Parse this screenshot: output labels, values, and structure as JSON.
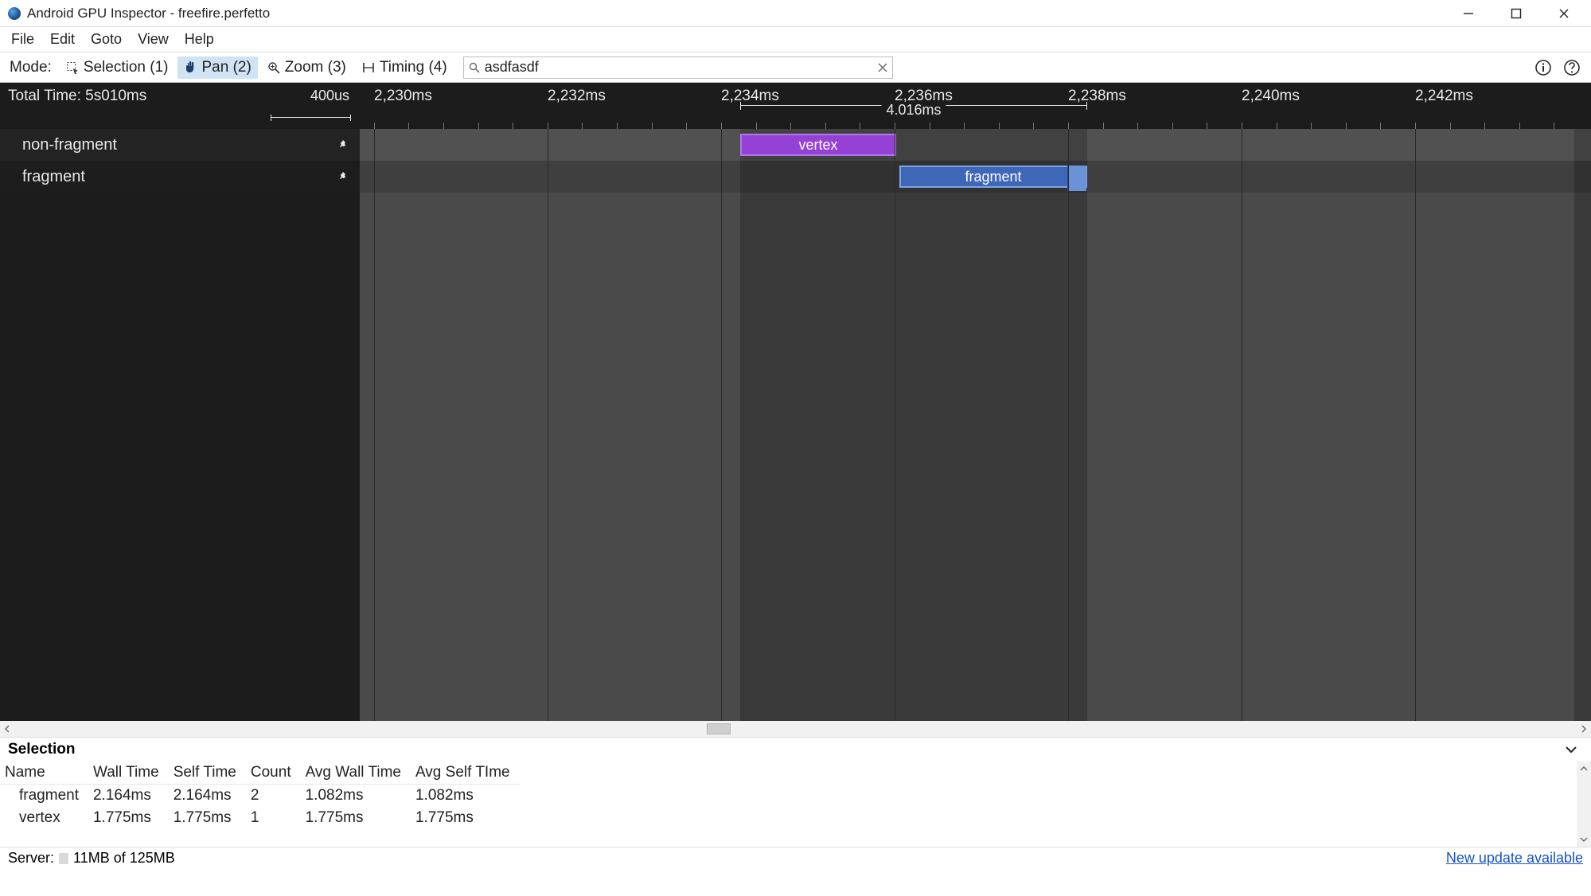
{
  "window": {
    "title": "Android GPU Inspector - freefire.perfetto"
  },
  "menu": {
    "file": "File",
    "edit": "Edit",
    "goto": "Goto",
    "view": "View",
    "help": "Help"
  },
  "toolbar": {
    "mode_label": "Mode:",
    "selection": "Selection (1)",
    "pan": "Pan (2)",
    "zoom": "Zoom (3)",
    "timing": "Timing (4)",
    "search_value": "asdfasdf"
  },
  "ruler": {
    "total_label": "Total Time: 5s010ms",
    "scale_unit": "400us",
    "ticks": [
      "2,230ms",
      "2,232ms",
      "2,234ms",
      "2,236ms",
      "2,238ms",
      "2,240ms",
      "2,242ms"
    ],
    "measure_label": "4.016ms"
  },
  "tracks": {
    "non_fragment": "non-fragment",
    "fragment": "fragment"
  },
  "slices": {
    "vertex_label": "vertex",
    "fragment_label": "fragment"
  },
  "selection": {
    "title": "Selection",
    "columns": [
      "Name",
      "Wall Time",
      "Self Time",
      "Count",
      "Avg Wall Time",
      "Avg Self TIme"
    ],
    "rows": [
      {
        "name": "fragment",
        "wall": "2.164ms",
        "self": "2.164ms",
        "count": "2",
        "avg_wall": "1.082ms",
        "avg_self": "1.082ms"
      },
      {
        "name": "vertex",
        "wall": "1.775ms",
        "self": "1.775ms",
        "count": "1",
        "avg_wall": "1.775ms",
        "avg_self": "1.775ms"
      }
    ]
  },
  "status": {
    "server_label": "Server:",
    "server_value": "11MB of 125MB",
    "update": "New update available"
  }
}
